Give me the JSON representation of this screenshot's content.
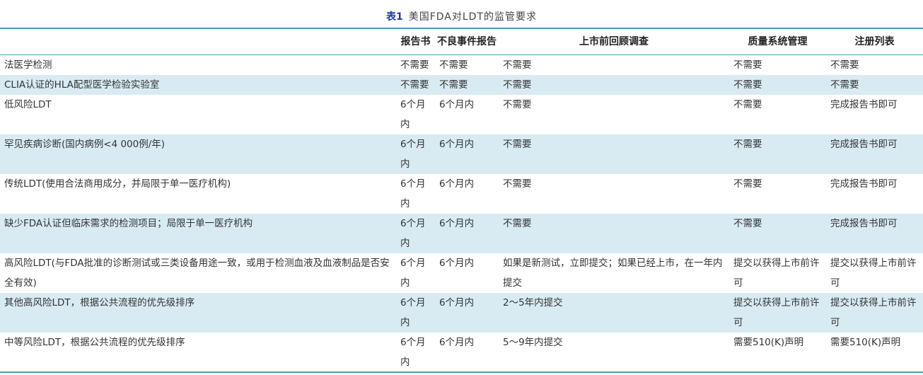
{
  "caption": {
    "label": "表1",
    "title": "美国FDA对LDT的监管要求"
  },
  "table": {
    "headers": [
      "",
      "报告书",
      "不良事件报告",
      "上市前回顾调查",
      "质量系统管理",
      "注册列表"
    ],
    "rows": [
      [
        "法医学检测",
        "不需要",
        "不需要",
        "不需要",
        "不需要",
        "不需要"
      ],
      [
        "CLIA认证的HLA配型医学检验实验室",
        "不需要",
        "不需要",
        "不需要",
        "不需要",
        "不需要"
      ],
      [
        "低风险LDT",
        "6个月内",
        "6个月内",
        "不需要",
        "不需要",
        "完成报告书即可"
      ],
      [
        "罕见疾病诊断(国内病例<4 000例/年)",
        "6个月内",
        "6个月内",
        "不需要",
        "不需要",
        "完成报告书即可"
      ],
      [
        "传统LDT(使用合法商用成分，并局限于单一医疗机构)",
        "6个月内",
        "6个月内",
        "不需要",
        "不需要",
        "完成报告书即可"
      ],
      [
        "缺少FDA认证但临床需求的检测项目；局限于单一医疗机构",
        "6个月内",
        "6个月内",
        "不需要",
        "不需要",
        "完成报告书即可"
      ],
      [
        "高风险LDT(与FDA批准的诊断测试或三类设备用途一致，或用于检测血液及血液制品是否安全有效)",
        "6个月内",
        "6个月内",
        "如果是新测试，立即提交；如果已经上市，在一年内提交",
        "提交以获得上市前许可",
        "提交以获得上市前许可"
      ],
      [
        "其他高风险LDT，根据公共流程的优先级排序",
        "6个月内",
        "6个月内",
        "2～5年内提交",
        "提交以获得上市前许可",
        "提交以获得上市前许可"
      ],
      [
        "中等风险LDT，根据公共流程的优先级排序",
        "6个月内",
        "6个月内",
        "5～9年内提交",
        "需要510(K)声明",
        "需要510(K)声明"
      ]
    ]
  }
}
